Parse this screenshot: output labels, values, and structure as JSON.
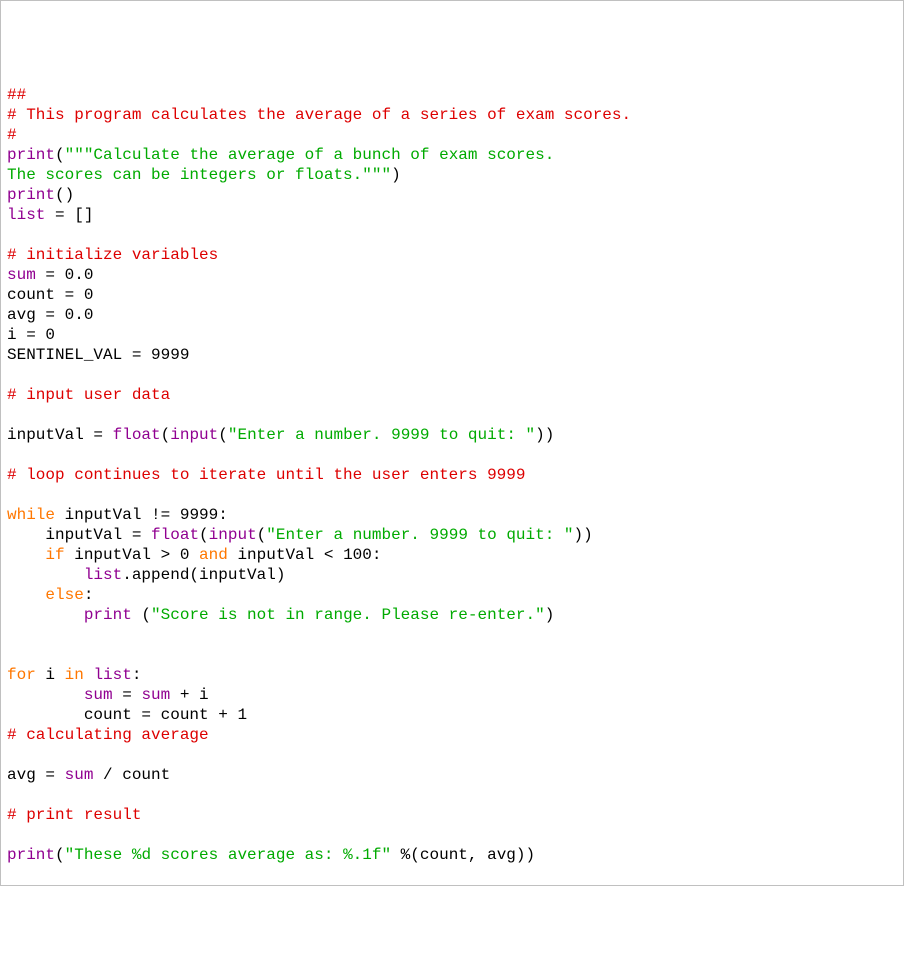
{
  "lines": [
    {
      "indent": 0,
      "tokens": [
        {
          "cls": "comment",
          "text": "##"
        }
      ]
    },
    {
      "indent": 0,
      "tokens": [
        {
          "cls": "comment",
          "text": "# This program calculates the average of a series of exam scores."
        }
      ]
    },
    {
      "indent": 0,
      "tokens": [
        {
          "cls": "comment",
          "text": "#"
        }
      ]
    },
    {
      "indent": 0,
      "tokens": [
        {
          "cls": "builtin",
          "text": "print"
        },
        {
          "cls": "black",
          "text": "("
        },
        {
          "cls": "string",
          "text": "\"\"\"Calculate the average of a bunch of exam scores."
        }
      ]
    },
    {
      "indent": 0,
      "tokens": [
        {
          "cls": "string",
          "text": "The scores can be integers or floats.\"\"\""
        },
        {
          "cls": "black",
          "text": ")"
        }
      ]
    },
    {
      "indent": 0,
      "tokens": [
        {
          "cls": "builtin",
          "text": "print"
        },
        {
          "cls": "black",
          "text": "()"
        }
      ]
    },
    {
      "indent": 0,
      "tokens": [
        {
          "cls": "builtin",
          "text": "list"
        },
        {
          "cls": "black",
          "text": " = []"
        }
      ]
    },
    {
      "indent": 0,
      "tokens": [
        {
          "cls": "black",
          "text": ""
        }
      ]
    },
    {
      "indent": 0,
      "tokens": [
        {
          "cls": "comment",
          "text": "# initialize variables"
        }
      ]
    },
    {
      "indent": 0,
      "tokens": [
        {
          "cls": "builtin",
          "text": "sum"
        },
        {
          "cls": "black",
          "text": " = 0.0"
        }
      ]
    },
    {
      "indent": 0,
      "tokens": [
        {
          "cls": "black",
          "text": "count = 0"
        }
      ]
    },
    {
      "indent": 0,
      "tokens": [
        {
          "cls": "black",
          "text": "avg = 0.0"
        }
      ]
    },
    {
      "indent": 0,
      "tokens": [
        {
          "cls": "black",
          "text": "i = 0"
        }
      ]
    },
    {
      "indent": 0,
      "tokens": [
        {
          "cls": "black",
          "text": "SENTINEL_VAL = 9999"
        }
      ]
    },
    {
      "indent": 0,
      "tokens": [
        {
          "cls": "black",
          "text": ""
        }
      ]
    },
    {
      "indent": 0,
      "tokens": [
        {
          "cls": "comment",
          "text": "# input user data"
        }
      ]
    },
    {
      "indent": 0,
      "tokens": [
        {
          "cls": "black",
          "text": ""
        }
      ]
    },
    {
      "indent": 0,
      "tokens": [
        {
          "cls": "black",
          "text": "inputVal = "
        },
        {
          "cls": "builtin",
          "text": "float"
        },
        {
          "cls": "black",
          "text": "("
        },
        {
          "cls": "builtin",
          "text": "input"
        },
        {
          "cls": "black",
          "text": "("
        },
        {
          "cls": "string",
          "text": "\"Enter a number. 9999 to quit: \""
        },
        {
          "cls": "black",
          "text": "))"
        }
      ]
    },
    {
      "indent": 0,
      "tokens": [
        {
          "cls": "black",
          "text": ""
        }
      ]
    },
    {
      "indent": 0,
      "tokens": [
        {
          "cls": "comment",
          "text": "# loop continues to iterate until the user enters 9999"
        }
      ]
    },
    {
      "indent": 0,
      "tokens": [
        {
          "cls": "black",
          "text": ""
        }
      ]
    },
    {
      "indent": 0,
      "tokens": [
        {
          "cls": "keyword",
          "text": "while"
        },
        {
          "cls": "black",
          "text": " inputVal != 9999:"
        }
      ]
    },
    {
      "indent": 1,
      "tokens": [
        {
          "cls": "black",
          "text": "inputVal = "
        },
        {
          "cls": "builtin",
          "text": "float"
        },
        {
          "cls": "black",
          "text": "("
        },
        {
          "cls": "builtin",
          "text": "input"
        },
        {
          "cls": "black",
          "text": "("
        },
        {
          "cls": "string",
          "text": "\"Enter a number. 9999 to quit: \""
        },
        {
          "cls": "black",
          "text": "))"
        }
      ]
    },
    {
      "indent": 1,
      "tokens": [
        {
          "cls": "keyword",
          "text": "if"
        },
        {
          "cls": "black",
          "text": " inputVal > 0 "
        },
        {
          "cls": "keyword",
          "text": "and"
        },
        {
          "cls": "black",
          "text": " inputVal < 100:"
        }
      ]
    },
    {
      "indent": 2,
      "tokens": [
        {
          "cls": "builtin",
          "text": "list"
        },
        {
          "cls": "black",
          "text": ".append(inputVal)"
        }
      ]
    },
    {
      "indent": 1,
      "tokens": [
        {
          "cls": "keyword",
          "text": "else"
        },
        {
          "cls": "black",
          "text": ":"
        }
      ]
    },
    {
      "indent": 2,
      "tokens": [
        {
          "cls": "builtin",
          "text": "print"
        },
        {
          "cls": "black",
          "text": " ("
        },
        {
          "cls": "string",
          "text": "\"Score is not in range. Please re-enter.\""
        },
        {
          "cls": "black",
          "text": ")"
        }
      ]
    },
    {
      "indent": 0,
      "tokens": [
        {
          "cls": "black",
          "text": ""
        }
      ]
    },
    {
      "indent": 0,
      "tokens": [
        {
          "cls": "black",
          "text": ""
        }
      ]
    },
    {
      "indent": 0,
      "tokens": [
        {
          "cls": "keyword",
          "text": "for"
        },
        {
          "cls": "black",
          "text": " i "
        },
        {
          "cls": "keyword",
          "text": "in"
        },
        {
          "cls": "black",
          "text": " "
        },
        {
          "cls": "builtin",
          "text": "list"
        },
        {
          "cls": "black",
          "text": ":"
        }
      ]
    },
    {
      "indent": 2,
      "tokens": [
        {
          "cls": "builtin",
          "text": "sum"
        },
        {
          "cls": "black",
          "text": " = "
        },
        {
          "cls": "builtin",
          "text": "sum"
        },
        {
          "cls": "black",
          "text": " + i"
        }
      ]
    },
    {
      "indent": 2,
      "tokens": [
        {
          "cls": "black",
          "text": "count = count + 1"
        }
      ]
    },
    {
      "indent": 0,
      "tokens": [
        {
          "cls": "comment",
          "text": "# calculating average"
        }
      ]
    },
    {
      "indent": 0,
      "tokens": [
        {
          "cls": "black",
          "text": ""
        }
      ]
    },
    {
      "indent": 0,
      "tokens": [
        {
          "cls": "black",
          "text": "avg = "
        },
        {
          "cls": "builtin",
          "text": "sum"
        },
        {
          "cls": "black",
          "text": " / count"
        }
      ]
    },
    {
      "indent": 0,
      "tokens": [
        {
          "cls": "black",
          "text": ""
        }
      ]
    },
    {
      "indent": 0,
      "tokens": [
        {
          "cls": "comment",
          "text": "# print result"
        }
      ]
    },
    {
      "indent": 0,
      "tokens": [
        {
          "cls": "black",
          "text": ""
        }
      ]
    },
    {
      "indent": 0,
      "tokens": [
        {
          "cls": "builtin",
          "text": "print"
        },
        {
          "cls": "black",
          "text": "("
        },
        {
          "cls": "string",
          "text": "\"These %d scores average as: %.1f\""
        },
        {
          "cls": "black",
          "text": " %(count, avg))"
        }
      ]
    }
  ],
  "indent_unit": "    "
}
